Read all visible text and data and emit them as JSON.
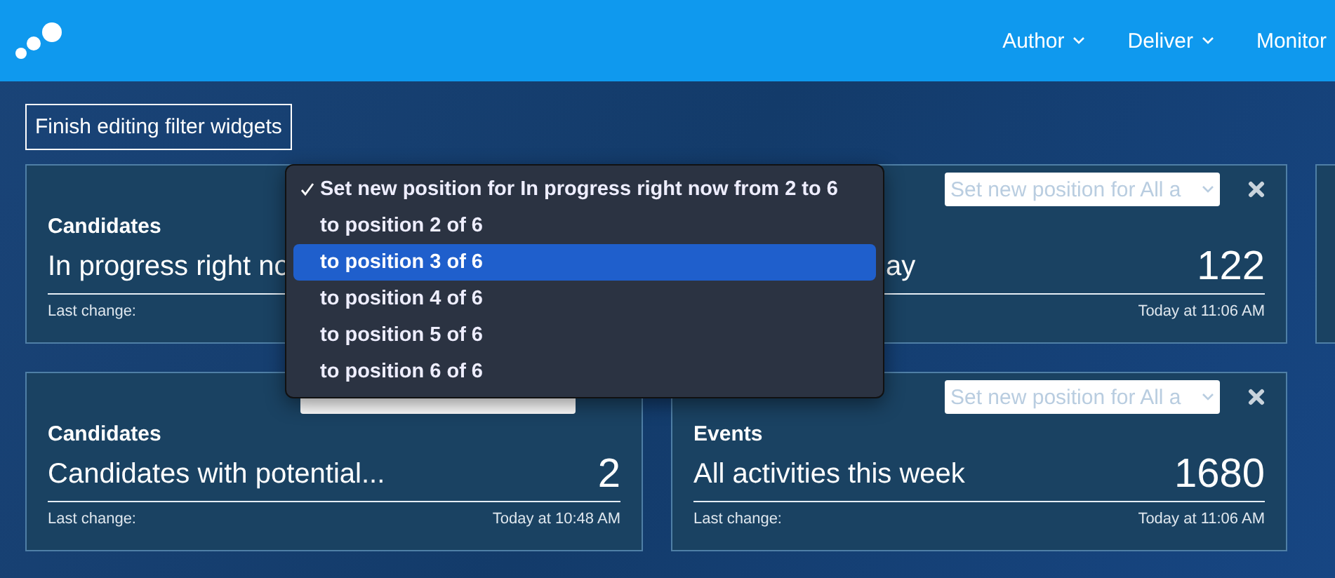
{
  "header": {
    "nav": [
      {
        "label": "Author",
        "dropdown": true
      },
      {
        "label": "Deliver",
        "dropdown": true
      },
      {
        "label": "Monitor",
        "dropdown": false
      }
    ]
  },
  "finish_button": "Finish editing filter widgets",
  "widgets": [
    {
      "kind": "widget",
      "category": "Candidates",
      "title": "In progress right no",
      "footer_label": "Last change:"
    },
    {
      "kind": "clipped",
      "title": "ay",
      "value": "122",
      "footer_time": "Today at 11:06 AM",
      "controls": {
        "placeholder": "Set new position for All a",
        "close": true
      }
    },
    {
      "kind": "partial"
    },
    {
      "kind": "widget",
      "category": "Candidates",
      "title": "Candidates with potential...",
      "value": "2",
      "footer_label": "Last change:",
      "footer_time": "Today at 10:48 AM",
      "controls": {
        "close": false
      }
    },
    {
      "kind": "widget",
      "category": "Events",
      "title": "All activities this week",
      "value": "1680",
      "footer_label": "Last change:",
      "footer_time": "Today at 11:06 AM",
      "controls": {
        "placeholder": "Set new position for All a",
        "close": true
      }
    }
  ],
  "position_menu": {
    "items": [
      {
        "label": "Set new position for In progress right now from 2 to 6",
        "checked": true,
        "selected": false
      },
      {
        "label": "to position 2 of 6",
        "checked": false,
        "selected": false
      },
      {
        "label": "to position 3 of 6",
        "checked": false,
        "selected": true
      },
      {
        "label": "to position 4 of 6",
        "checked": false,
        "selected": false
      },
      {
        "label": "to position 5 of 6",
        "checked": false,
        "selected": false
      },
      {
        "label": "to position 6 of 6",
        "checked": false,
        "selected": false
      }
    ]
  }
}
